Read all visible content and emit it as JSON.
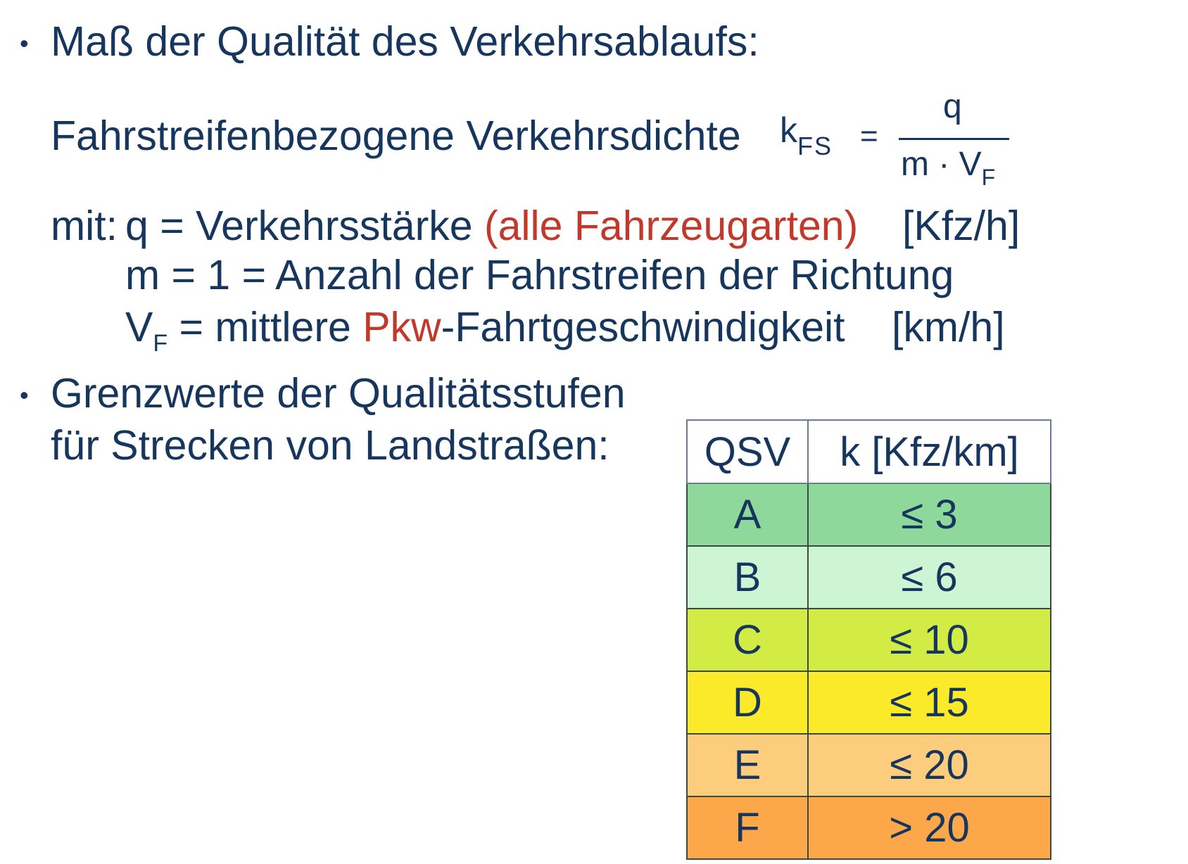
{
  "bullet1": {
    "marker": "•",
    "text": "Maß der Qualität des Verkehrsablaufs:"
  },
  "formula": {
    "label": "Fahrstreifenbezogene Verkehrsdichte",
    "lhs_main": "k",
    "lhs_sub": "FS",
    "equals": "=",
    "numerator": "q",
    "denominator_main": "m · V",
    "denominator_sub": "F"
  },
  "definitions": {
    "prefix": "mit:",
    "q": {
      "text": "q = Verkehrsstärke",
      "highlight": "(alle Fahrzeugarten)",
      "unit": "[Kfz/h]"
    },
    "m": {
      "text": "m = 1 = Anzahl der Fahrstreifen der Richtung"
    },
    "vf": {
      "symbol_main": "V",
      "symbol_sub": "F",
      "text_before": " = mittlere ",
      "highlight": "Pkw",
      "text_after": "-Fahrtgeschwindigkeit",
      "unit": "[km/h]"
    }
  },
  "bullet2": {
    "marker": "•",
    "line1": "Grenzwerte der Qualitätsstufen",
    "line2": "für Strecken von Landstraßen:"
  },
  "table": {
    "headers": [
      "QSV",
      "k [Kfz/km]"
    ],
    "rows": [
      {
        "qsv": "A",
        "k": "≤ 3",
        "color": "#8fd89b"
      },
      {
        "qsv": "B",
        "k": "≤ 6",
        "color": "#cdf5d3"
      },
      {
        "qsv": "C",
        "k": "≤ 10",
        "color": "#d2ec45"
      },
      {
        "qsv": "D",
        "k": "≤ 15",
        "color": "#fbea2a"
      },
      {
        "qsv": "E",
        "k": "≤ 20",
        "color": "#fccd7d"
      },
      {
        "qsv": "F",
        "k": "> 20",
        "color": "#fba74a"
      }
    ]
  },
  "colors": {
    "text": "#17365d",
    "highlight": "#c0392b"
  }
}
